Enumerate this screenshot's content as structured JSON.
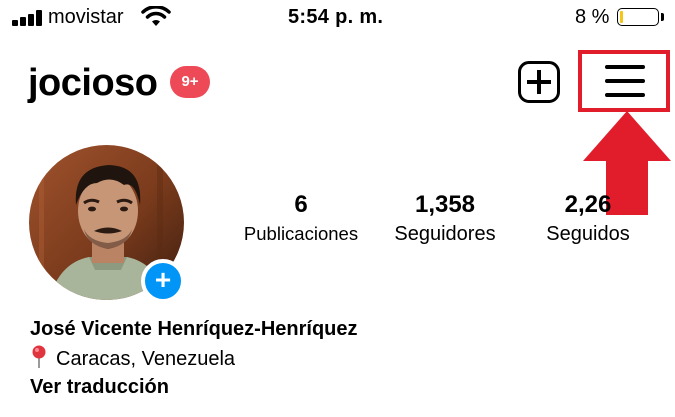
{
  "status_bar": {
    "carrier": "movistar",
    "time": "5:54 p. m.",
    "battery_percent": "8 %",
    "battery_level": 0.08
  },
  "header": {
    "username": "jocioso",
    "notification_badge": "9+"
  },
  "profile": {
    "avatar_add_symbol": "+",
    "stats": {
      "posts": {
        "value": "6",
        "label": "Publicaciones"
      },
      "followers": {
        "value": "1,358",
        "label": "Seguidores"
      },
      "following": {
        "value": "2,26",
        "label": "Seguidos"
      }
    },
    "full_name": "José Vicente Henríquez-Henríquez",
    "location": "Caracas, Venezuela",
    "translate_link": "Ver traducción"
  },
  "colors": {
    "badge": "#ed4956",
    "highlight": "#e11d2b",
    "add_story": "#0095f6",
    "battery_low": "#f5c518"
  },
  "icons": [
    "signal-icon",
    "wifi-icon",
    "battery-icon",
    "new-post-icon",
    "hamburger-menu-icon",
    "arrow-up-icon",
    "location-pin-icon"
  ]
}
